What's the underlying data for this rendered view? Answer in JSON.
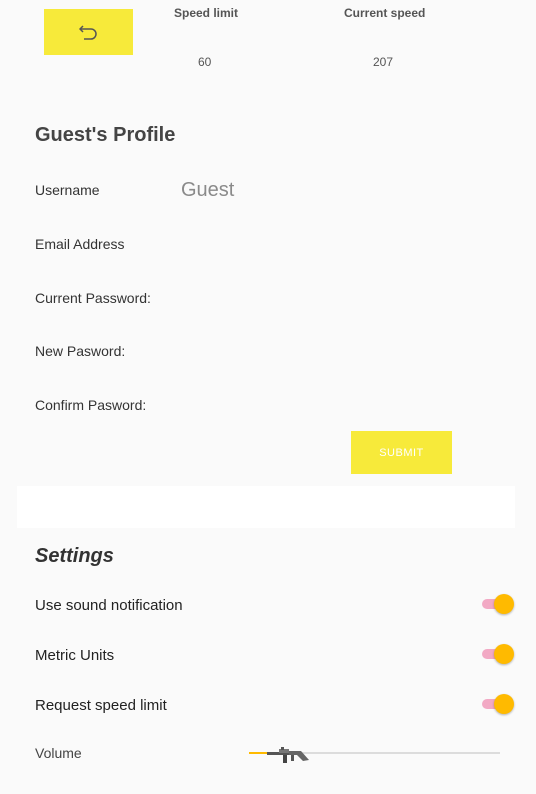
{
  "topbar": {
    "back_icon": "undo-arrow-icon",
    "speed_limit_label": "Speed limit",
    "speed_limit_value": "60",
    "current_speed_label": "Current speed",
    "current_speed_value": "207"
  },
  "profile": {
    "title": "Guest's Profile",
    "fields": [
      {
        "label": "Username",
        "value": "Guest"
      },
      {
        "label": "Email Address",
        "value": ""
      },
      {
        "label": "Current Password:",
        "value": ""
      },
      {
        "label": "New Pasword:",
        "value": ""
      },
      {
        "label": "Confirm Pasword:",
        "value": ""
      }
    ],
    "submit_label": "SUBMIT"
  },
  "settings": {
    "title": "Settings",
    "items": [
      {
        "label": "Use sound notification",
        "on": true
      },
      {
        "label": "Metric Units",
        "on": true
      },
      {
        "label": "Request speed limit",
        "on": true
      }
    ],
    "volume_label": "Volume",
    "volume_value": 0.07,
    "volume_thumb_icon": "gun-icon"
  },
  "colors": {
    "accent_yellow": "#f7ea3a",
    "toggle_knob": "#ffba00",
    "toggle_track": "#f2a9c4"
  }
}
